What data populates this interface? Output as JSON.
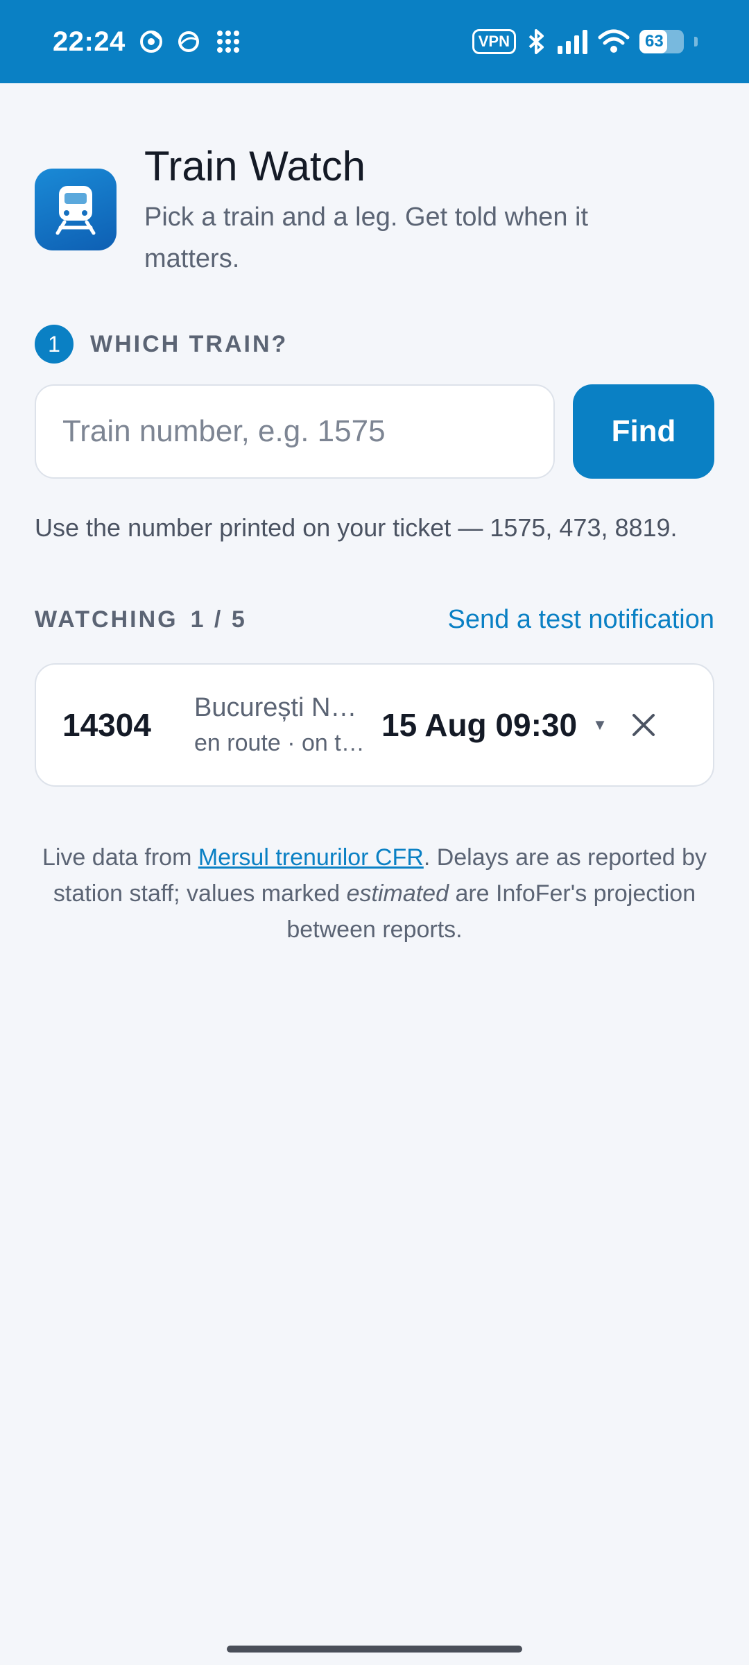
{
  "status_bar": {
    "time": "22:24",
    "icons": [
      "chrome-icon",
      "browser-icon",
      "apps-grid-icon"
    ],
    "vpn_label": "VPN",
    "battery_level": "63",
    "battery_fraction": 0.63
  },
  "header": {
    "title": "Train Watch",
    "subtitle": "Pick a train and a leg. Get told when it matters."
  },
  "step": {
    "number": "1",
    "label": "WHICH TRAIN?"
  },
  "search": {
    "placeholder": "Train number, e.g. 1575",
    "value": "",
    "button_label": "Find"
  },
  "hint": "Use the number printed on your ticket — 1575, 473, 8819.",
  "watching": {
    "label": "WATCHING",
    "count": "1 / 5",
    "test_link": "Send a test notification",
    "items": [
      {
        "train_number": "14304",
        "route": "București Nord",
        "status": "en route · on time",
        "departure": "15 Aug 09:30"
      }
    ]
  },
  "footer": {
    "prefix": "Live data from ",
    "link": "Mersul trenurilor CFR",
    "middle": ". Delays are as reported by station staff; values marked ",
    "emphasis": "estimated",
    "suffix": " are InfoFer's projection between reports."
  },
  "colors": {
    "primary": "#0a80c4",
    "background": "#f4f6fa"
  }
}
